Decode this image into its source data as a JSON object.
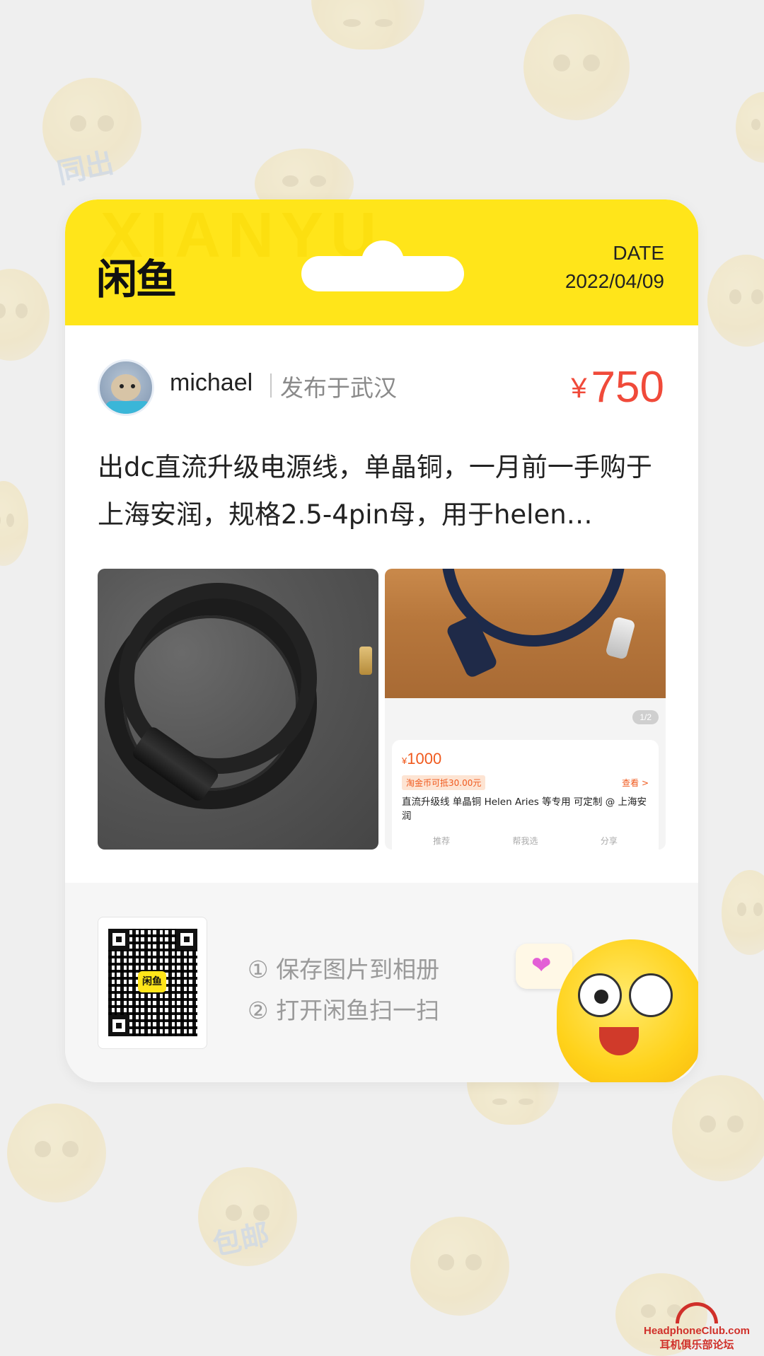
{
  "header": {
    "logo_text": "闲鱼",
    "watermark_text": "XIANYU",
    "date_label": "DATE",
    "date_value": "2022/04/09"
  },
  "seller": {
    "name": "michael",
    "location": "发布于武汉"
  },
  "price": {
    "currency": "¥",
    "amount": "750"
  },
  "description": "出dc直流升级电源线，单晶铜，一月前一手购于上海安润，规格2.5-4pin母，用于helen…",
  "screenshot_listing": {
    "page_indicator": "1/2",
    "price_currency": "¥",
    "price_amount": "1000",
    "coupon": "淘金币可抵30.00元",
    "view_link": "查看 >",
    "title": "直流升级线 单晶铜 Helen Aries 等专用 可定制 @ 上海安润",
    "actions": [
      "推荐",
      "帮我选",
      "分享"
    ]
  },
  "bottom": {
    "qr_logo": "闲鱼",
    "step1": "① 保存图片到相册",
    "step2": "② 打开闲鱼扫一扫"
  },
  "background_tags": [
    "同出",
    "包邮"
  ],
  "site_watermark": {
    "line1": "HeadphoneClub.com",
    "line2": "耳机俱乐部论坛"
  },
  "colors": {
    "accent_yellow": "#ffe51a",
    "price_red": "#f04a3a",
    "background": "#efefef"
  }
}
